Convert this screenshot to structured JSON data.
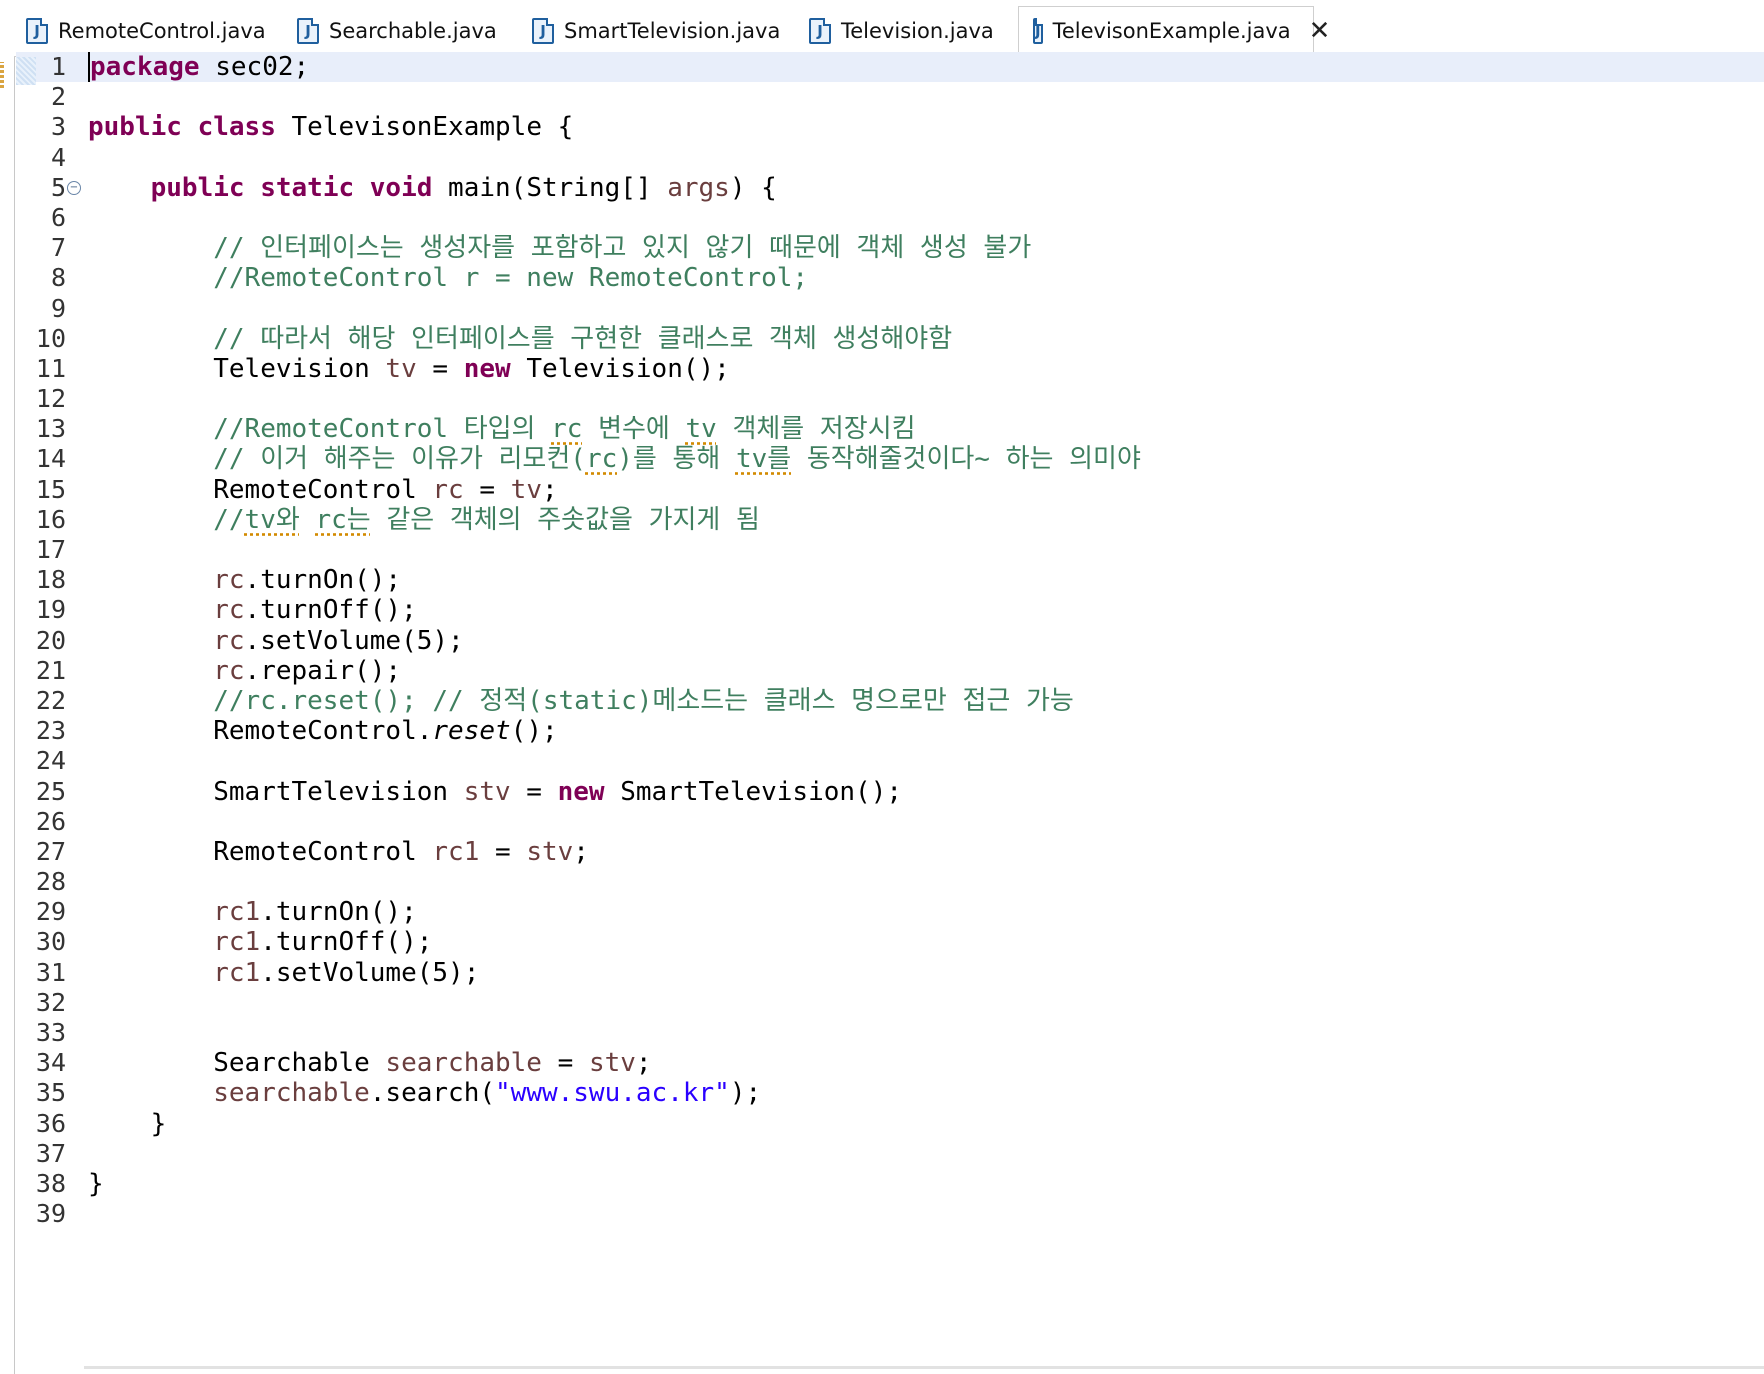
{
  "tabs": [
    {
      "label": "RemoteControl.java",
      "icon": "java-file-icon"
    },
    {
      "label": "Searchable.java",
      "icon": "java-file-icon"
    },
    {
      "label": "SmartTelevision.java",
      "icon": "java-file-icon"
    },
    {
      "label": "Television.java",
      "icon": "java-file-icon"
    },
    {
      "label": "TelevisonExample.java",
      "icon": "java-file-icon",
      "active": true
    }
  ],
  "code": {
    "l1a": "package",
    "l1b": " sec02;",
    "l3a": "public",
    "l3b": "class",
    "l3c": " TelevisonExample {",
    "l5a": "public",
    "l5b": "static",
    "l5c": "void",
    "l5d": " main(String[] ",
    "l5e": "args",
    "l5f": ") {",
    "l7": "// 인터페이스는 생성자를 포함하고 있지 않기 때문에 객체 생성 불가",
    "l8": "//RemoteControl r = new RemoteControl;",
    "l10": "// 따라서 해당 인터페이스를 구현한 클래스로 객체 생성해야함",
    "l11a": "Television ",
    "l11b": "tv",
    "l11c": " = ",
    "l11d": "new",
    "l11e": " Television();",
    "l13a": "//RemoteControl 타입의 ",
    "l13b": "rc",
    "l13c": " 변수에 ",
    "l13d": "tv",
    "l13e": " 객체를 저장시킴",
    "l14a": "// 이거 해주는 이유가 리모컨(",
    "l14b": "rc",
    "l14c": ")를 통해 ",
    "l14d": "tv를",
    "l14e": " 동작해줄것이다~ 하는 의미야",
    "l15a": "RemoteControl ",
    "l15b": "rc",
    "l15c": " = ",
    "l15d": "tv",
    "l15e": ";",
    "l16a": "//",
    "l16b": "tv와",
    "l16c": " ",
    "l16d": "rc는",
    "l16e": " 같은 객체의 주솟값을 가지게 됨",
    "l18a": "rc",
    "l18b": ".turnOn();",
    "l19a": "rc",
    "l19b": ".turnOff();",
    "l20a": "rc",
    "l20b": ".setVolume(5);",
    "l21a": "rc",
    "l21b": ".repair();",
    "l22": "//rc.reset(); // 정적(static)메소드는 클래스 명으로만 접근 가능",
    "l23a": "RemoteControl.",
    "l23b": "reset",
    "l23c": "();",
    "l25a": "SmartTelevision ",
    "l25b": "stv",
    "l25c": " = ",
    "l25d": "new",
    "l25e": " SmartTelevision();",
    "l27a": "RemoteControl ",
    "l27b": "rc1",
    "l27c": " = ",
    "l27d": "stv",
    "l27e": ";",
    "l29a": "rc1",
    "l29b": ".turnOn();",
    "l30a": "rc1",
    "l30b": ".turnOff();",
    "l31a": "rc1",
    "l31b": ".setVolume(5);",
    "l34a": "Searchable ",
    "l34b": "searchable",
    "l34c": " = ",
    "l34d": "stv",
    "l34e": ";",
    "l35a": "searchable",
    "l35b": ".search(",
    "l35c": "\"www.swu.ac.kr\"",
    "l35d": ");",
    "l36": "}",
    "l38": "}"
  },
  "colors": {
    "keyword": "#7f0055",
    "comment": "#3f7f5f",
    "local_variable": "#6a3e3e",
    "string": "#2a00ff"
  }
}
